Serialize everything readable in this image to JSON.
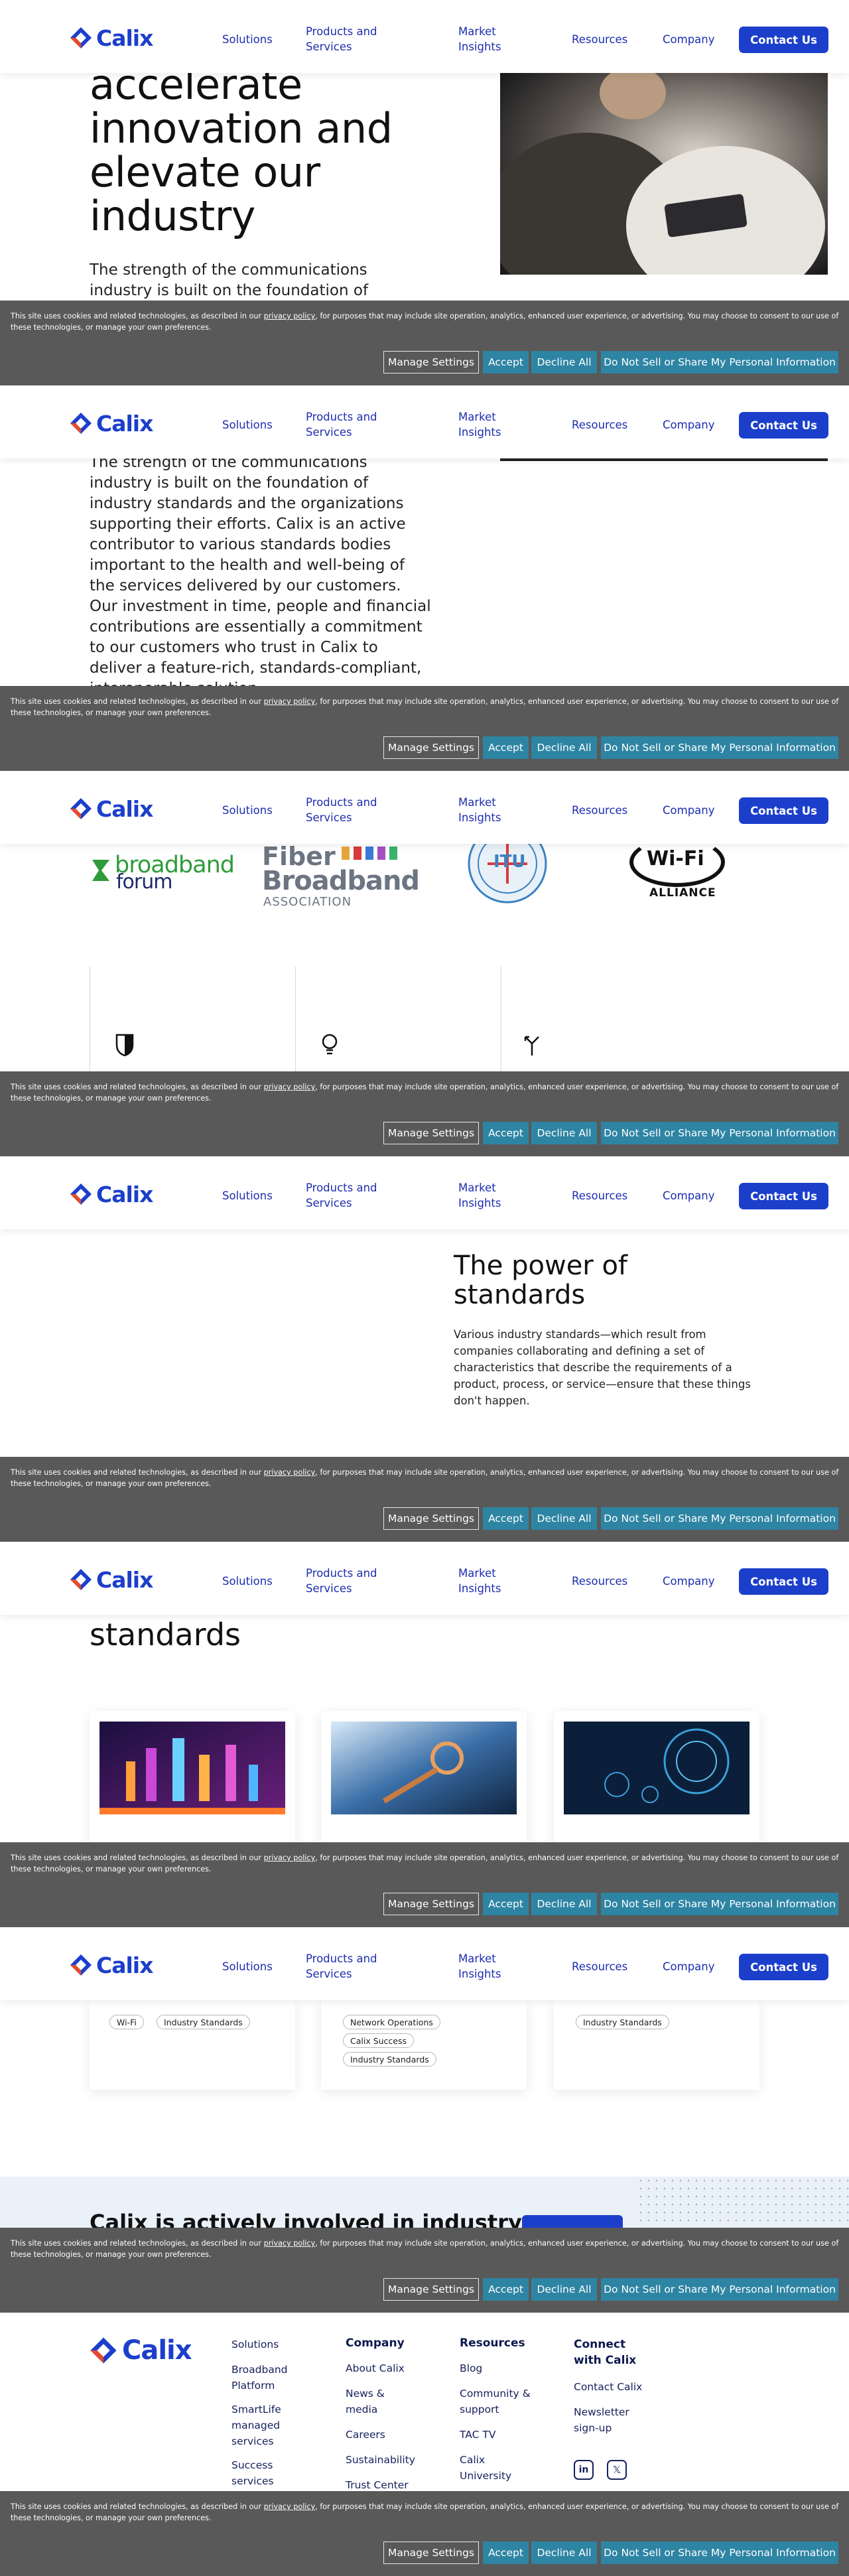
{
  "header": {
    "logo_text": "Calix",
    "nav": [
      "Solutions",
      "Products and\nServices",
      "Market\nInsights",
      "Resources",
      "Company"
    ],
    "contact_label": "Contact Us"
  },
  "cookie": {
    "text_before": "This site uses cookies and related technologies, as described in our ",
    "link": "privacy policy",
    "text_after": ", for purposes that may include site operation, analytics, enhanced user experience, or advertising. You may choose to consent to our use of these technologies, or manage your own preferences.",
    "buttons": {
      "manage": "Manage Settings",
      "accept": "Accept",
      "decline": "Decline All",
      "dnsl": "Do Not Sell or Share My Personal Information"
    }
  },
  "hero": {
    "heading_lines": [
      "accelerate",
      "innovation and",
      "elevate our",
      "industry"
    ],
    "body_lines": [
      "The strength of the communications",
      "industry is built on the foundation of",
      "industry standards and the organizations",
      "supporting their efforts. Calix is an active",
      "contributor to various standards bodies",
      "important to the health and well-being of",
      "the services delivered by our customers.",
      "Our investment in time, people and financial",
      "contributions are essentially a commitment",
      "to our customers who trust in Calix to",
      "deliver a feature-rich, standards-compliant,",
      "interoperable solution."
    ]
  },
  "partners": {
    "broadband_forum": [
      "broadband",
      "forum"
    ],
    "fiber_broadband": [
      "Fiber",
      "Broadband",
      "ASSOCIATION"
    ],
    "itu": "ITU",
    "wifi": [
      "Wi-Fi",
      "ALLIANCE"
    ]
  },
  "power": {
    "heading_lines": [
      "The power of",
      "standards"
    ],
    "body_lines": [
      "Various industry standards—which result from",
      "companies collaborating and defining a set of",
      "characteristics that describe the requirements of a",
      "product, process, or service—ensure that these things",
      "don't happen."
    ]
  },
  "resources": {
    "heading": "standards",
    "cards": [
      {
        "tags": [
          "Wi-Fi",
          "Industry Standards"
        ]
      },
      {
        "tags": [
          "Network Operations",
          "Calix Success",
          "Industry Standards"
        ]
      },
      {
        "tags": [
          "Industry Standards"
        ]
      }
    ]
  },
  "cta": {
    "text": "Calix is actively involved in industry"
  },
  "footer": {
    "logo_text": "Calix",
    "col1": [
      "Solutions",
      "Broadband\nPlatform",
      "SmartLife\nmanaged\nservices",
      "Success\nservices"
    ],
    "col2_head": "Company",
    "col2": [
      "About Calix",
      "News &\nmedia",
      "Careers",
      "Sustainability",
      "Trust Center"
    ],
    "col3_head": "Resources",
    "col3": [
      "Blog",
      "Community &\nsupport",
      "TAC TV",
      "Calix\nUniversity"
    ],
    "col4_head": "Connect\nwith Calix",
    "col4": [
      "Contact Calix",
      "Newsletter\nsign-up"
    ]
  }
}
